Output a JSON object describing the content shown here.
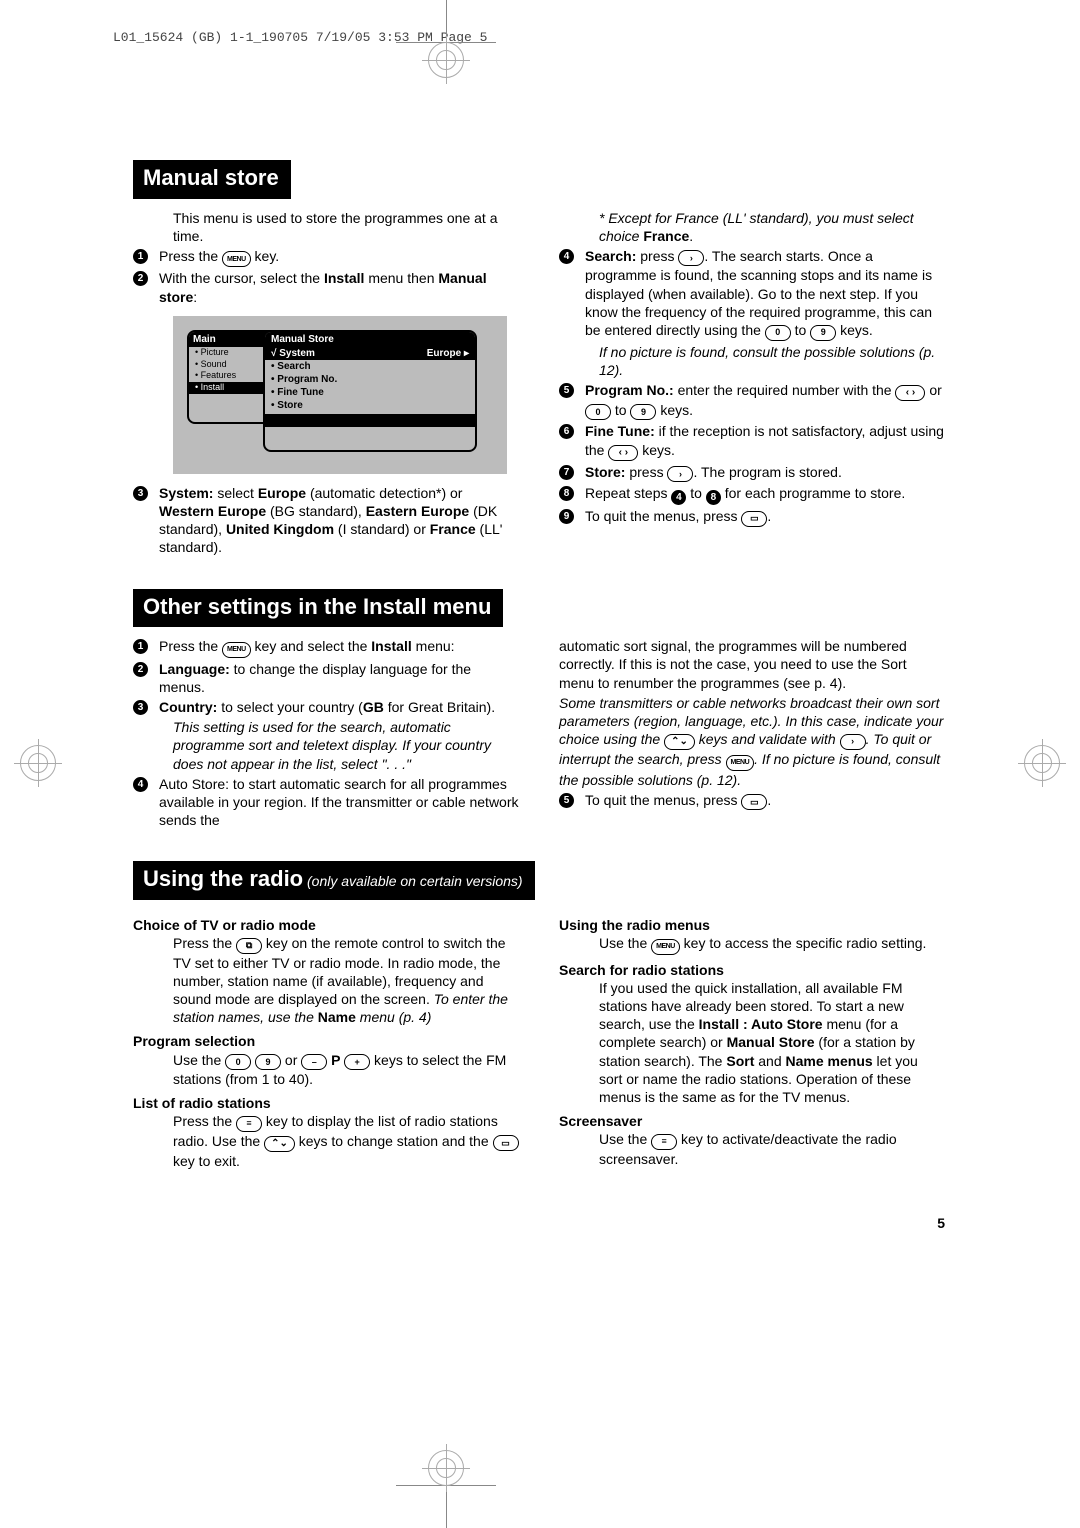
{
  "header": "L01_15624 (GB) 1-1_190705  7/19/05  3:53 PM  Page 5",
  "page_number": "5",
  "manual_store": {
    "title": "Manual store",
    "intro": "This menu is used to store the programmes one at a time.",
    "s1_a": "Press the ",
    "s1_key": "MENU",
    "s1_b": " key.",
    "s2_a": "With the cursor, select the ",
    "s2_b": "Install",
    "s2_c": " menu then ",
    "s2_d": "Manual store",
    "s2_e": ":",
    "s3_a": "System:",
    "s3_b": " select ",
    "s3_c": "Europe",
    "s3_d": " (automatic detection*) or ",
    "s3_e": "Western Europe",
    "s3_f": " (BG standard), ",
    "s3_g": "Eastern Europe",
    "s3_h": " (DK standard), ",
    "s3_i": "United Kingdom",
    "s3_j": " (I standard) or ",
    "s3_k": "France",
    "s3_l": " (LL' standard).",
    "note_a": "* Except for France (LL' standard), you must select choice ",
    "note_b": "France",
    "note_c": ".",
    "s4_a": "Search:",
    "s4_b": " press ",
    "s4_c": ". The search starts. Once a programme is found, the scanning stops and its name is displayed (when available). Go to the next step. If you know the frequency of the required programme, this can be entered directly using the ",
    "s4_d": " to ",
    "s4_e": " keys.",
    "s4_it": "If no picture is found, consult the possible solutions (p. 12).",
    "s5_a": "Program No.:",
    "s5_b": " enter the required number with the ",
    "s5_c": " or ",
    "s5_d": " to ",
    "s5_e": " keys.",
    "s6_a": "Fine Tune:",
    "s6_b": " if the reception is not satisfactory, adjust using the ",
    "s6_c": " keys.",
    "s7_a": "Store:",
    "s7_b": " press ",
    "s7_c": ". The program is stored.",
    "s8_a": "Repeat steps ",
    "s8_b": " to ",
    "s8_c": " for each programme to store.",
    "s9_a": "To quit the menus, press ",
    "s9_b": ".",
    "osd": {
      "main_title": "Main",
      "main_items": [
        "• Picture",
        "• Sound",
        "• Features",
        "• Install"
      ],
      "sub_title": "Manual Store",
      "sub_sel_left": "√ System",
      "sub_sel_right": "Europe ▸",
      "sub_items": [
        "• Search",
        "• Program No.",
        "• Fine Tune",
        "• Store"
      ]
    }
  },
  "other": {
    "title": "Other settings in the Install menu",
    "s1_a": "Press the ",
    "s1_b": " key and select the ",
    "s1_c": "Install",
    "s1_d": " menu:",
    "s2_a": "Language:",
    "s2_b": " to change the display language for the menus.",
    "s3_a": "Country:",
    "s3_b": " to select your country (",
    "s3_c": "GB",
    "s3_d": " for Great Britain).",
    "s3_it": "This setting is used for the search, automatic programme sort and teletext display. If your country does not appear in the list, select \". . .\"",
    "s4": "Auto Store: to start automatic search for all programmes available in your region. If the transmitter or cable network sends the",
    "r1": "automatic sort signal, the programmes will be numbered correctly. If this is not the case, you need to use the Sort menu to renumber the programmes (see p. 4).",
    "r_it_a": "Some transmitters or cable networks broadcast their own sort parameters (region, language, etc.). In this case, indicate your choice using the ",
    "r_it_b": " keys and validate with ",
    "r_it_c": ". To quit or interrupt the search, press ",
    "r_it_d": ". If no picture is found, consult the possible solutions (p. 12).",
    "s5_a": "To quit the menus, press ",
    "s5_b": "."
  },
  "radio": {
    "title_a": "Using the radio",
    "title_b": " (only available on certain versions)",
    "h1": "Choice of TV or radio mode",
    "p1_a": "Press the ",
    "p1_b": " key on the remote control to switch the TV set to either TV or radio mode. In radio mode, the number, station name (if available), frequency and sound mode are displayed on the screen. ",
    "p1_it_a": "To enter the station names, use the ",
    "p1_it_b": "Name",
    "p1_it_c": " menu (p. 4)",
    "h2": "Program selection",
    "p2_a": "Use the ",
    "p2_b": " or ",
    "p2_c": " P ",
    "p2_d": " keys to select the FM stations (from 1 to 40).",
    "h3": "List of radio stations",
    "p3_a": "Press the ",
    "p3_b": " key to display the list of radio stations radio. Use the ",
    "p3_c": " keys to change station and the ",
    "p3_d": " key to exit.",
    "h4": "Using the radio menus",
    "p4_a": "Use the ",
    "p4_b": " key to access the specific radio setting.",
    "h5": "Search for radio stations",
    "p5_a": "If you used the quick installation, all available FM stations have already been stored. To start a new search, use the ",
    "p5_b": "Install : Auto Store",
    "p5_c": " menu (for a complete search) or ",
    "p5_d": "Manual Store",
    "p5_e": " (for a station by station search). The ",
    "p5_f": "Sort",
    "p5_g": " and ",
    "p5_h": "Name menus",
    "p5_i": " let you sort or name the radio stations. Operation of these menus is the same as for the TV menus.",
    "h6": "Screensaver",
    "p6_a": "Use the ",
    "p6_b": " key to activate/deactivate the radio screensaver."
  },
  "keys": {
    "menu": "MENU",
    "zero": "0",
    "nine": "9",
    "right": "›",
    "leftright": "‹ ›",
    "updown": "⌃⌄",
    "minus": "–",
    "plus": "+",
    "quit": "▭",
    "list": "≡",
    "tvradio": "⧉"
  }
}
